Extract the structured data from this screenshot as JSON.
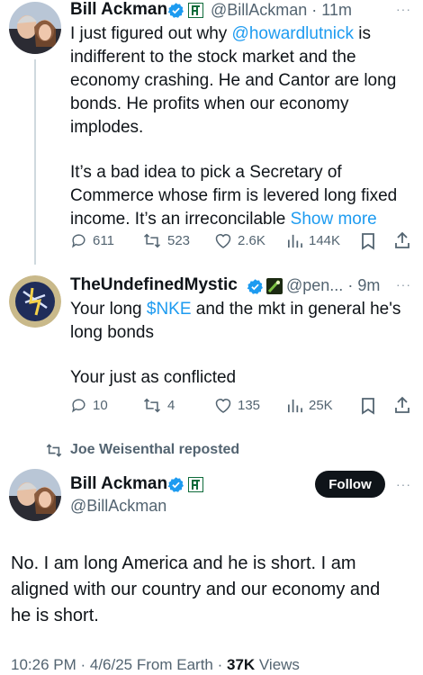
{
  "colors": {
    "accent": "#1d9bf0",
    "text": "#0f1419",
    "muted": "#536471",
    "verified": "#1d9bf0",
    "affiliate": "#0e6b3a"
  },
  "tweet1": {
    "author_name": "Bill Ackman",
    "handle": "@BillAckman",
    "time": "11m",
    "more": "···",
    "line1_pre": "I just figured out why ",
    "mention": "@howardlutnick",
    "line1_post": " is",
    "lines": [
      "indifferent to the stock market and the",
      "economy crashing. He and Cantor are long",
      "bonds. He profits when our economy",
      "implodes."
    ],
    "para2": [
      "It’s a bad idea to pick a Secretary of",
      "Commerce whose firm is levered long fixed"
    ],
    "last_line": "income. It’s an irreconcilable",
    "show_more": "Show more",
    "replies": "611",
    "reposts": "523",
    "likes": "2.6K",
    "views": "144K"
  },
  "tweet2": {
    "author_name": "TheUndefinedMystic",
    "handle": "@pen...",
    "time": "9m",
    "more": "···",
    "line1_pre": "Your long ",
    "cashtag": "$NKE",
    "line1_post": " and the mkt in general  he's",
    "line2": "long bonds",
    "line3": "Your just as conflicted",
    "replies": "10",
    "reposts": "4",
    "likes": "135",
    "views": "25K"
  },
  "repost_banner": {
    "text": "Joe Weisenthal reposted"
  },
  "main_tweet": {
    "author_name": "Bill Ackman",
    "handle": "@BillAckman",
    "follow_label": "Follow",
    "more": "···",
    "lines": [
      "No. I am long America and he is short. I am",
      "aligned with our country and our economy and",
      "he is short."
    ],
    "meta_time": "10:26 PM · 4/6/25 From Earth · ",
    "views_count": "37K",
    "views_label": " Views"
  }
}
